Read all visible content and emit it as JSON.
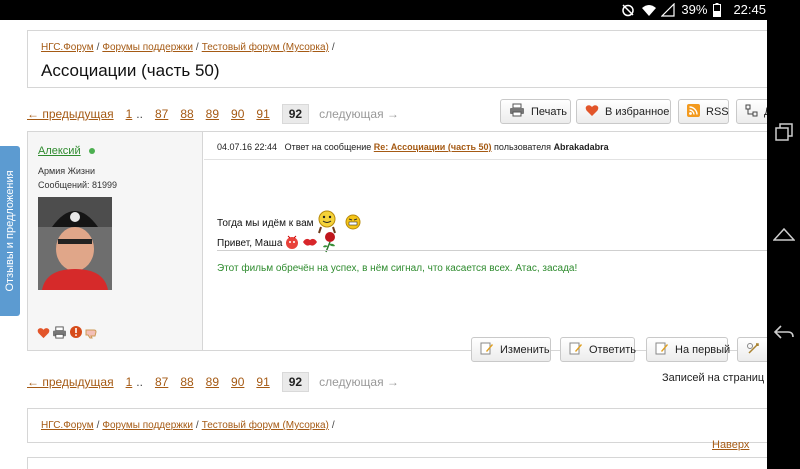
{
  "status_bar": {
    "battery": "39%",
    "time": "22:45"
  },
  "feedback_tab": "Отзывы и предложения",
  "breadcrumb": [
    "НГС.Форум",
    "Форумы поддержки",
    "Тестовый форум (Мусорка)"
  ],
  "breadcrumb_sep": "/",
  "page_title": "Ассоциации (часть 50)",
  "pager": {
    "prev": "← предыдущая",
    "first": "1",
    "dots": "..",
    "pages": [
      "87",
      "88",
      "89",
      "90",
      "91"
    ],
    "current": "92",
    "next": "следующая →"
  },
  "toolbar": {
    "print": "Печать",
    "favorite": "В избранное",
    "rss": "RSS",
    "more": "Д"
  },
  "post": {
    "author": "Алексий",
    "rank": "Армия Жизни",
    "messages": "Сообщений: 81999",
    "datetime": "04.07.16 22:44",
    "reply_prefix": "Ответ на сообщение",
    "reply_link": "Re: Ассоциации (часть 50)",
    "user_prefix": "пользователя",
    "reply_user": "Abrakadabra",
    "line1": "Тогда мы идём к вам",
    "line2": "Привет, Маша",
    "signature": "Этот фильм обречён на успех, в нём сигнал, что касается всех. Атас, засада!",
    "actions": {
      "edit": "Изменить",
      "reply": "Ответить",
      "first": "На первый"
    }
  },
  "records_label": "Записей на страниц",
  "back_to_top": "Наверх"
}
